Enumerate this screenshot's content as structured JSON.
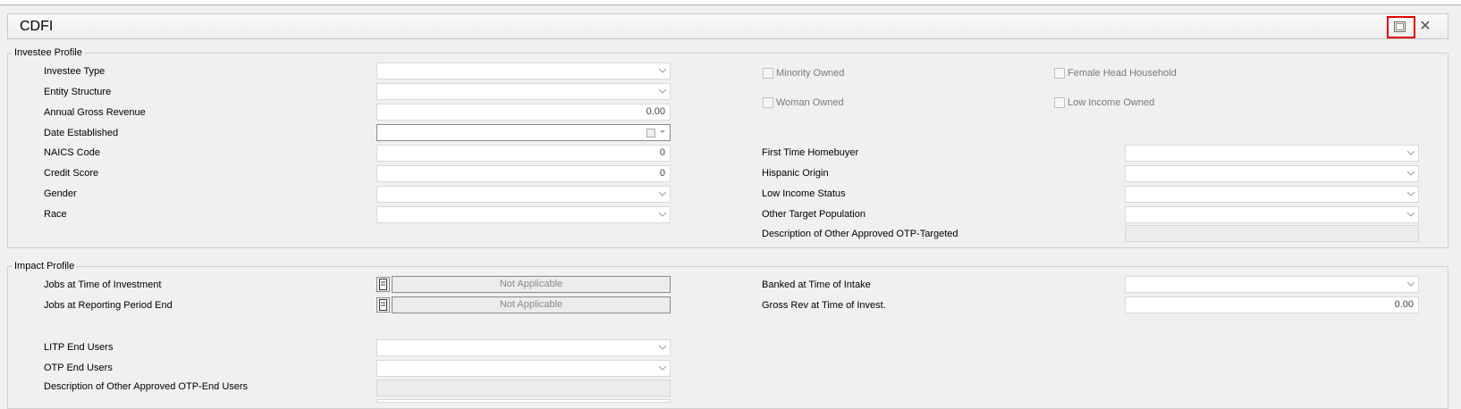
{
  "window": {
    "title": "CDFI"
  },
  "icons": {
    "restore": "restore-window-icon",
    "close": "close-x-icon"
  },
  "investee_profile": {
    "title": "Investee Profile",
    "investee_type": {
      "label": "Investee Type",
      "value": ""
    },
    "entity_structure": {
      "label": "Entity Structure",
      "value": ""
    },
    "annual_gross_revenue": {
      "label": "Annual Gross Revenue",
      "value": "0.00"
    },
    "date_established": {
      "label": "Date Established",
      "value": ""
    },
    "naics_code": {
      "label": "NAICS Code",
      "value": "0"
    },
    "credit_score": {
      "label": "Credit Score",
      "value": "0"
    },
    "gender": {
      "label": "Gender",
      "value": ""
    },
    "race": {
      "label": "Race",
      "value": ""
    },
    "checkboxes": {
      "minority_owned": {
        "label": "Minority Owned",
        "checked": false
      },
      "female_head_household": {
        "label": "Female Head Household",
        "checked": false
      },
      "woman_owned": {
        "label": "Woman Owned",
        "checked": false
      },
      "low_income_owned": {
        "label": "Low Income Owned",
        "checked": false
      }
    },
    "first_time_homebuyer": {
      "label": "First Time Homebuyer",
      "value": ""
    },
    "hispanic_origin": {
      "label": "Hispanic Origin",
      "value": ""
    },
    "low_income_status": {
      "label": "Low Income Status",
      "value": ""
    },
    "other_target_population": {
      "label": "Other Target Population",
      "value": ""
    },
    "desc_other_otp_targeted": {
      "label": "Description of Other Approved OTP-Targeted",
      "value": ""
    }
  },
  "impact_profile": {
    "title": "Impact Profile",
    "jobs_at_investment": {
      "label": "Jobs at Time of Investment",
      "value": "Not Applicable"
    },
    "jobs_at_period_end": {
      "label": "Jobs at Reporting Period End",
      "value": "Not Applicable"
    },
    "banked_at_intake": {
      "label": "Banked at Time of Intake",
      "value": ""
    },
    "gross_rev_at_invest": {
      "label": "Gross Rev at Time of Invest.",
      "value": "0.00"
    },
    "litp_end_users": {
      "label": "LITP End Users",
      "value": ""
    },
    "otp_end_users": {
      "label": "OTP End Users",
      "value": ""
    },
    "desc_other_otp_end_users": {
      "label": "Description of Other Approved OTP-End Users",
      "value": ""
    }
  }
}
